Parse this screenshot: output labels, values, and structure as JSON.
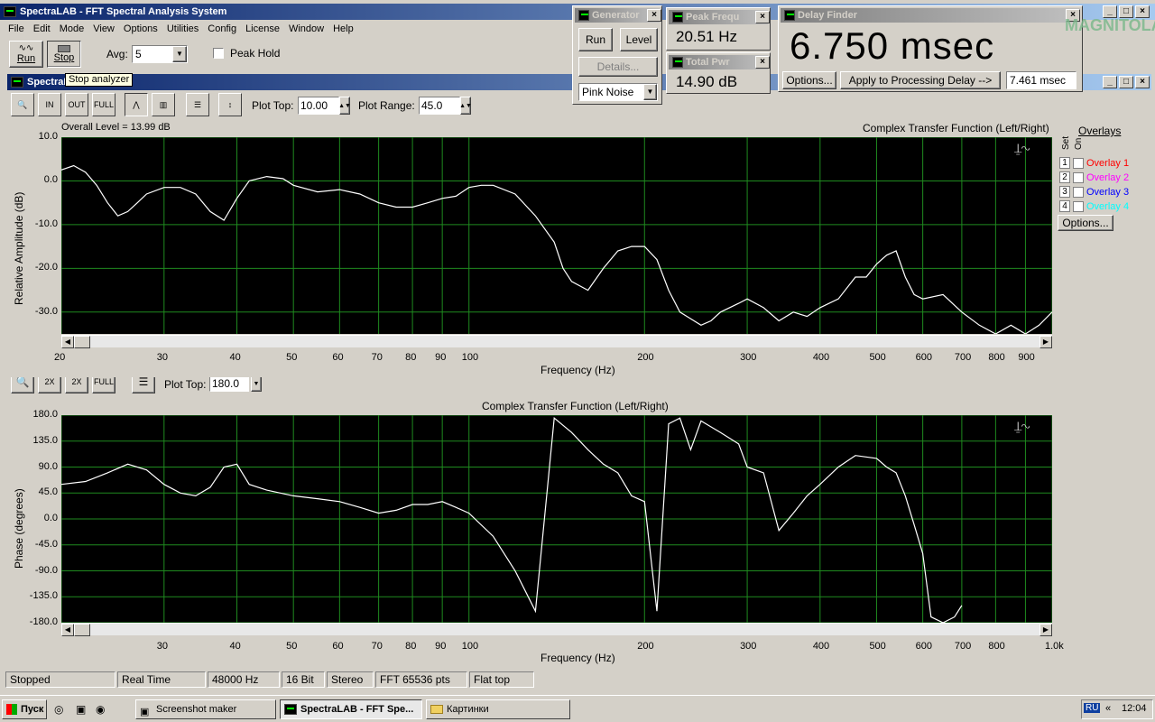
{
  "app": {
    "title": "SpectraLAB - FFT Spectral Analysis System"
  },
  "menu": [
    "File",
    "Edit",
    "Mode",
    "View",
    "Options",
    "Utilities",
    "Config",
    "License",
    "Window",
    "Help"
  ],
  "toolbar": {
    "run_label": "Run",
    "stop_label": "Stop",
    "avg_label": "Avg:",
    "avg_value": "5",
    "peak_hold_label": "Peak Hold",
    "tooltip": "Stop analyzer"
  },
  "inner_window": {
    "title": "SpectraL"
  },
  "plot_toolbar": {
    "plot_top_label": "Plot Top:",
    "plot_top_value": "10.00",
    "plot_range_label": "Plot Range:",
    "plot_range_value": "45.0",
    "bottom_plot_top_label": "Plot Top:",
    "bottom_plot_top_value": "180.0"
  },
  "generator": {
    "title": "Generator",
    "run_label": "Run",
    "level_label": "Level",
    "details_label": "Details...",
    "noise_type": "Pink Noise"
  },
  "peak_freq": {
    "title": "Peak Frequ",
    "value": "20.51 Hz"
  },
  "total_pwr": {
    "title": "Total Pwr",
    "value": "14.90 dB"
  },
  "delay_finder": {
    "title": "Delay Finder",
    "value": "6.750 msec",
    "options_label": "Options...",
    "apply_label": "Apply to Processing Delay -->",
    "delay_value": "7.461 msec"
  },
  "watermark": "MAGNITOLA",
  "overlays": {
    "title": "Overlays",
    "set_label": "Set",
    "on_label": "On",
    "items": [
      {
        "num": "1",
        "label": "Overlay 1",
        "color": "#ff0000"
      },
      {
        "num": "2",
        "label": "Overlay 2",
        "color": "#ff00ff"
      },
      {
        "num": "3",
        "label": "Overlay 3",
        "color": "#0000ff"
      },
      {
        "num": "4",
        "label": "Overlay 4",
        "color": "#00ffff"
      }
    ],
    "options_label": "Options..."
  },
  "top_plot": {
    "overall_level": "Overall Level = 13.99 dB",
    "title": "Complex Transfer Function (Left/Right)",
    "ylabel": "Relative Amplitude (dB)",
    "xlabel": "Frequency (Hz)",
    "yticks": [
      "10.0",
      "0.0",
      "-10.0",
      "-20.0",
      "-30.0"
    ],
    "xticks": [
      "20",
      "30",
      "40",
      "50",
      "60",
      "70",
      "80",
      "90",
      "100",
      "200",
      "300",
      "400",
      "500",
      "600",
      "700",
      "800",
      "900"
    ]
  },
  "bottom_plot": {
    "title": "Complex Transfer Function (Left/Right)",
    "ylabel": "Phase (degrees)",
    "xlabel": "Frequency (Hz)",
    "yticks": [
      "180.0",
      "135.0",
      "90.0",
      "45.0",
      "0.0",
      "-45.0",
      "-90.0",
      "-135.0",
      "-180.0"
    ],
    "xticks": [
      "30",
      "40",
      "50",
      "60",
      "70",
      "80",
      "90",
      "100",
      "200",
      "300",
      "400",
      "500",
      "600",
      "700",
      "800",
      "1.0k"
    ]
  },
  "status": [
    "Stopped",
    "Real Time",
    "48000 Hz",
    "16 Bit",
    "Stereo",
    "FFT 65536 pts",
    "Flat top"
  ],
  "taskbar": {
    "start": "Пуск",
    "items": [
      "Screenshot maker",
      "SpectraLAB - FFT Spe...",
      "Картинки"
    ],
    "lang": "RU",
    "clock": "12:04"
  },
  "chart_data": [
    {
      "type": "line",
      "title": "Complex Transfer Function (Left/Right)",
      "xlabel": "Frequency (Hz)",
      "ylabel": "Relative Amplitude (dB)",
      "xscale": "log",
      "xlim": [
        20,
        1000
      ],
      "ylim": [
        -35,
        10
      ],
      "grid": true,
      "series": [
        {
          "x": [
            20,
            21,
            22,
            23,
            24,
            25,
            26,
            27,
            28,
            30,
            32,
            34,
            36,
            38,
            40,
            42,
            45,
            48,
            50,
            55,
            60,
            65,
            70,
            75,
            80,
            85,
            90,
            95,
            100,
            105,
            110,
            120,
            130,
            140,
            145,
            150,
            160,
            170,
            180,
            190,
            200,
            210,
            220,
            230,
            250,
            260,
            270,
            290,
            300,
            320,
            340,
            360,
            380,
            400,
            430,
            460,
            480,
            500,
            520,
            540,
            560,
            580,
            600,
            650,
            700,
            750,
            800,
            850,
            900,
            950,
            1000
          ],
          "y": [
            2.5,
            3.5,
            2,
            -1,
            -5,
            -8,
            -7,
            -5,
            -3,
            -1.5,
            -1.5,
            -3,
            -7,
            -9,
            -4,
            0,
            1,
            0.5,
            -1,
            -2.5,
            -2,
            -3,
            -5,
            -6,
            -6,
            -5,
            -4,
            -3.5,
            -1.5,
            -1,
            -1,
            -3,
            -8,
            -14,
            -20,
            -23,
            -25,
            -20,
            -16,
            -15,
            -15,
            -18,
            -25,
            -30,
            -33,
            -32,
            -30,
            -28,
            -27,
            -29,
            -32,
            -30,
            -31,
            -29,
            -27,
            -22,
            -22,
            -19,
            -17,
            -16,
            -22,
            -26,
            -27,
            -26,
            -30,
            -33,
            -35,
            -33,
            -35,
            -33,
            -30
          ]
        }
      ]
    },
    {
      "type": "line",
      "title": "Complex Transfer Function (Left/Right)",
      "xlabel": "Frequency (Hz)",
      "ylabel": "Phase (degrees)",
      "xscale": "log",
      "xlim": [
        20,
        1000
      ],
      "ylim": [
        -180,
        180
      ],
      "grid": true,
      "series": [
        {
          "x": [
            20,
            22,
            24,
            26,
            28,
            30,
            32,
            34,
            36,
            38,
            40,
            42,
            45,
            50,
            55,
            60,
            65,
            70,
            75,
            80,
            85,
            90,
            95,
            100,
            110,
            120,
            130,
            140,
            150,
            160,
            170,
            180,
            190,
            200,
            210,
            220,
            230,
            240,
            250,
            270,
            290,
            300,
            320,
            340,
            360,
            380,
            400,
            430,
            460,
            500,
            520,
            540,
            560,
            580,
            600,
            620,
            650,
            680,
            700
          ],
          "y": [
            60,
            65,
            80,
            95,
            85,
            60,
            45,
            40,
            55,
            90,
            95,
            60,
            50,
            40,
            35,
            30,
            20,
            10,
            15,
            25,
            25,
            30,
            20,
            10,
            -30,
            -90,
            -160,
            175,
            150,
            120,
            95,
            80,
            40,
            30,
            -160,
            165,
            175,
            120,
            170,
            150,
            130,
            90,
            80,
            -20,
            10,
            40,
            60,
            90,
            110,
            105,
            90,
            80,
            40,
            -10,
            -60,
            -170,
            -180,
            -170,
            -150
          ]
        }
      ]
    }
  ]
}
